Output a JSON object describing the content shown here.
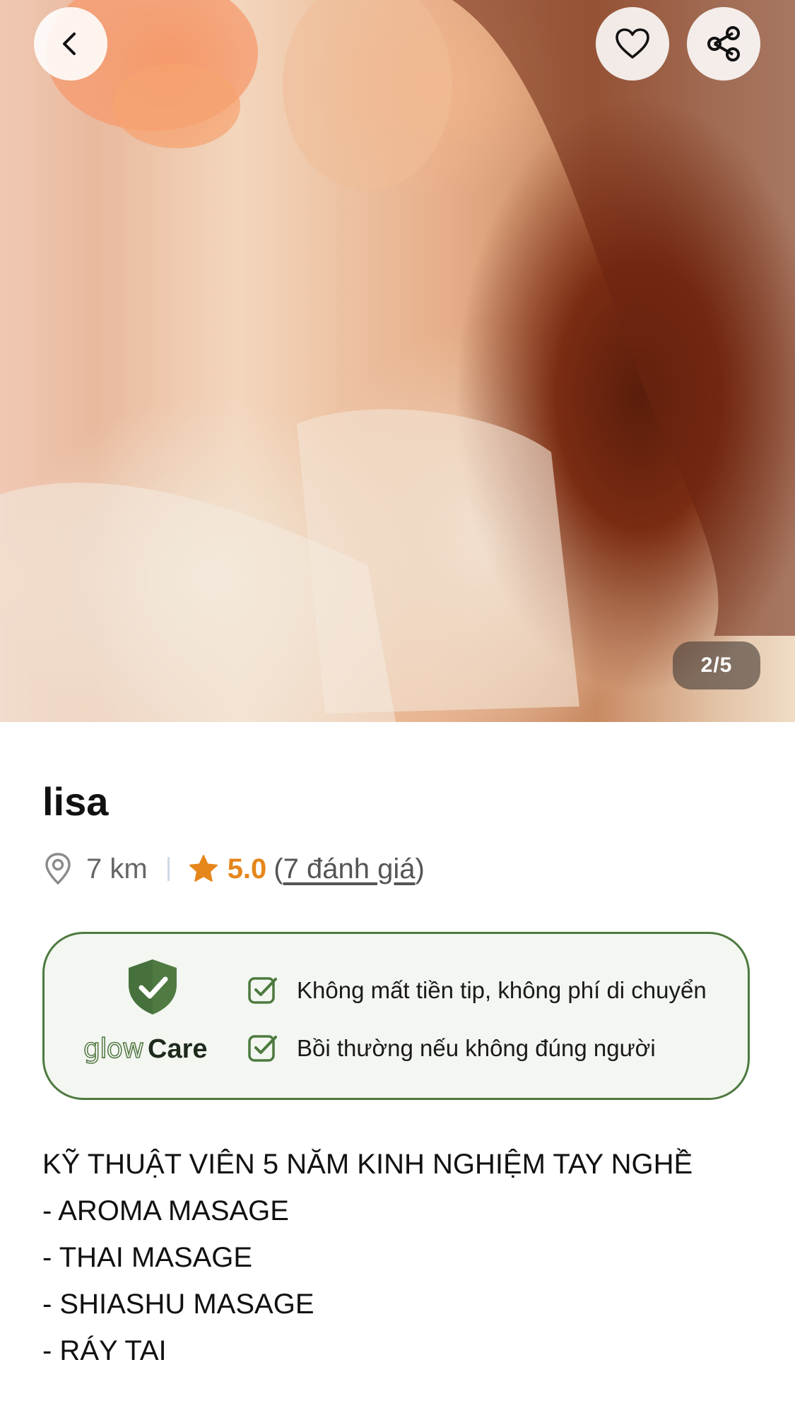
{
  "gallery": {
    "photo": "therapist-photo",
    "counter": "2/5"
  },
  "icons": {
    "back": "chevron-left-icon",
    "favorite": "heart-icon",
    "share": "share-icon",
    "location": "location-pin-icon",
    "rating": "star-icon",
    "care_shield": "shield-check-icon",
    "care_check": "checkbox-icon"
  },
  "profile": {
    "name": "lisa",
    "distance": "7 km",
    "rating": "5.0",
    "reviews_open": "(",
    "reviews": "7 đánh giá",
    "reviews_close": ")"
  },
  "care": {
    "brand_glow": "glow",
    "brand_care": "Care",
    "items": [
      "Không mất tiền tip, không phí di chuyển",
      "Bồi thường nếu không đúng người"
    ]
  },
  "description": [
    "KỸ THUẬT VIÊN 5 NĂM KINH NGHIỆM TAY NGHỀ",
    "- AROMA MASAGE",
    "- THAI MASAGE",
    "- SHIASHU MASAGE",
    "- RÁY TAI"
  ],
  "colors": {
    "rating": "#e5861b",
    "care_border": "#4d7a3f",
    "care_bg": "#f3f6f1",
    "shield": "#4f7b42"
  }
}
